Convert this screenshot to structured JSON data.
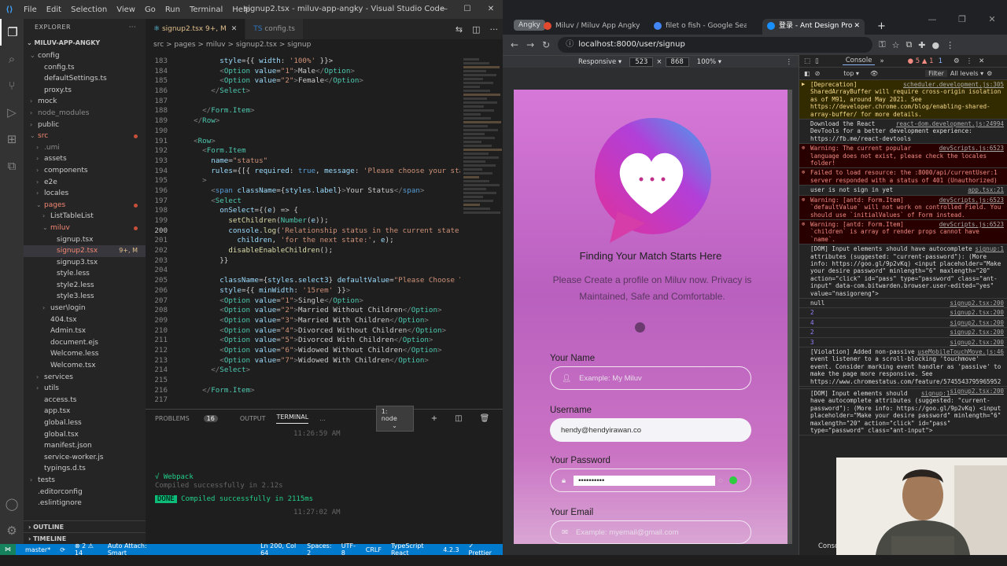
{
  "vscode": {
    "menu": [
      "File",
      "Edit",
      "Selection",
      "View",
      "Go",
      "Run",
      "Terminal",
      "Help"
    ],
    "title": "signup2.tsx - miluv-app-angky - Visual Studio Code",
    "explorer_label": "EXPLORER",
    "project": "MILUV-APP-ANGKY",
    "tree": [
      {
        "label": "config",
        "icon": "chevron-down",
        "indent": 1
      },
      {
        "label": "config.ts",
        "indent": 2
      },
      {
        "label": "defaultSettings.ts",
        "indent": 2
      },
      {
        "label": "proxy.ts",
        "indent": 2
      },
      {
        "label": "mock",
        "icon": "chevron-right",
        "indent": 1
      },
      {
        "label": "node_modules",
        "icon": "chevron-right",
        "indent": 1,
        "dim": true
      },
      {
        "label": "public",
        "icon": "chevron-right",
        "indent": 1
      },
      {
        "label": "src",
        "icon": "chevron-down",
        "indent": 1,
        "error": true,
        "dot": true
      },
      {
        "label": ".umi",
        "icon": "chevron-right",
        "indent": 2,
        "dim": true
      },
      {
        "label": "assets",
        "icon": "chevron-right",
        "indent": 2
      },
      {
        "label": "components",
        "icon": "chevron-right",
        "indent": 2
      },
      {
        "label": "e2e",
        "icon": "chevron-right",
        "indent": 2
      },
      {
        "label": "locales",
        "icon": "chevron-right",
        "indent": 2
      },
      {
        "label": "pages",
        "icon": "chevron-down",
        "indent": 2,
        "error": true,
        "dot": true
      },
      {
        "label": "ListTableList",
        "icon": "chevron-right",
        "indent": 3
      },
      {
        "label": "miluv",
        "icon": "chevron-down",
        "indent": 3,
        "error": true,
        "dot": true
      },
      {
        "label": "signup.tsx",
        "indent": 4
      },
      {
        "label": "signup2.tsx",
        "indent": 4,
        "error": true,
        "selected": true,
        "mod": "9+, M"
      },
      {
        "label": "signup3.tsx",
        "indent": 4
      },
      {
        "label": "style.less",
        "indent": 4
      },
      {
        "label": "style2.less",
        "indent": 4
      },
      {
        "label": "style3.less",
        "indent": 4
      },
      {
        "label": "user\\login",
        "icon": "chevron-right",
        "indent": 3
      },
      {
        "label": "404.tsx",
        "indent": 3
      },
      {
        "label": "Admin.tsx",
        "indent": 3
      },
      {
        "label": "document.ejs",
        "indent": 3
      },
      {
        "label": "Welcome.less",
        "indent": 3
      },
      {
        "label": "Welcome.tsx",
        "indent": 3
      },
      {
        "label": "services",
        "icon": "chevron-right",
        "indent": 2
      },
      {
        "label": "utils",
        "icon": "chevron-right",
        "indent": 2
      },
      {
        "label": "access.ts",
        "indent": 2
      },
      {
        "label": "app.tsx",
        "indent": 2
      },
      {
        "label": "global.less",
        "indent": 2
      },
      {
        "label": "global.tsx",
        "indent": 2
      },
      {
        "label": "manifest.json",
        "indent": 2
      },
      {
        "label": "service-worker.js",
        "indent": 2
      },
      {
        "label": "typings.d.ts",
        "indent": 2
      },
      {
        "label": "tests",
        "icon": "chevron-right",
        "indent": 1
      },
      {
        "label": ".editorconfig",
        "indent": 1
      },
      {
        "label": ".eslintignore",
        "indent": 1
      }
    ],
    "outline": "OUTLINE",
    "timeline": "TIMELINE",
    "tabs": [
      {
        "label": "signup2.tsx",
        "mod": "9+, M",
        "active": true
      },
      {
        "label": "config.ts",
        "active": false
      }
    ],
    "breadcrumb": "src > pages > miluv > signup2.tsx > signup",
    "code": [
      {
        "n": "183",
        "html": "        <span class='a'>style</span>={{ <span class='a'>width</span>: <span class='s'>'100%'</span> }}>"
      },
      {
        "n": "184",
        "html": "        <span class='p'>&lt;</span><span class='t'>Option</span> <span class='a'>value</span>=<span class='s'>\"1\"</span><span class='p'>&gt;</span>Male<span class='p'>&lt;/</span><span class='t'>Option</span><span class='p'>&gt;</span>"
      },
      {
        "n": "185",
        "html": "        <span class='p'>&lt;</span><span class='t'>Option</span> <span class='a'>value</span>=<span class='s'>\"2\"</span><span class='p'>&gt;</span>Female<span class='p'>&lt;/</span><span class='t'>Option</span><span class='p'>&gt;</span>"
      },
      {
        "n": "186",
        "html": "      <span class='p'>&lt;/</span><span class='t'>Select</span><span class='p'>&gt;</span>"
      },
      {
        "n": "187",
        "html": ""
      },
      {
        "n": "188",
        "html": "    <span class='p'>&lt;/</span><span class='t'>Form.Item</span><span class='p'>&gt;</span>"
      },
      {
        "n": "189",
        "html": "  <span class='p'>&lt;/</span><span class='t'>Row</span><span class='p'>&gt;</span>"
      },
      {
        "n": "190",
        "html": ""
      },
      {
        "n": "191",
        "html": "  <span class='p'>&lt;</span><span class='t'>Row</span><span class='p'>&gt;</span>"
      },
      {
        "n": "192",
        "html": "    <span class='p'>&lt;</span><span class='t'>Form.Item</span>"
      },
      {
        "n": "193",
        "html": "      <span class='a'>name</span>=<span class='s'>\"status\"</span>"
      },
      {
        "n": "194",
        "html": "      <span class='a'>rules</span>={[{ <span class='a'>required</span>: <span class='k'>true</span>, <span class='a'>message</span>: <span class='s'>'Please choose your status!'</span>"
      },
      {
        "n": "195",
        "html": "    <span class='p'>&gt;</span>"
      },
      {
        "n": "196",
        "html": "      <span class='p'>&lt;</span><span class='k'>span</span> <span class='a'>className</span>={<span class='v'>styles</span>.<span class='v'>label</span>}<span class='p'>&gt;</span>Your Status<span class='p'>&lt;/</span><span class='k'>span</span><span class='p'>&gt;</span>"
      },
      {
        "n": "197",
        "html": "      <span class='p'>&lt;</span><span class='t'>Select</span>"
      },
      {
        "n": "198",
        "html": "        <span class='a'>onSelect</span>={(<span class='v'>e</span>) =&gt; {"
      },
      {
        "n": "199",
        "html": "          <span class='f'>setChildren</span>(<span class='t'>Number</span>(<span class='v'>e</span>));"
      },
      {
        "n": "200",
        "html": "          <span class='v'>console</span>.<span class='f'>log</span>(<span class='s'>'Relationship status in the current state'</span>,",
        "cur": true
      },
      {
        "n": "201",
        "html": "            <span class='v'>children</span>, <span class='s'>'for the next state:'</span>, <span class='v'>e</span>);"
      },
      {
        "n": "202",
        "html": "          <span class='f'>disableEnableChildren</span>();"
      },
      {
        "n": "203",
        "html": "        }}"
      },
      {
        "n": "204",
        "html": ""
      },
      {
        "n": "205",
        "html": "        <span class='a'>className</span>={<span class='v'>styles</span>.<span class='v'>select3</span>} <span class='a'>defaultValue</span>=<span class='s'>\"Please Choose Your S</span>"
      },
      {
        "n": "206",
        "html": "        <span class='a'>style</span>={{ <span class='a'>minWidth</span>: <span class='s'>'15rem'</span> }}<span class='p'>&gt;</span>"
      },
      {
        "n": "207",
        "html": "        <span class='p'>&lt;</span><span class='t'>Option</span> <span class='a'>value</span>=<span class='s'>\"1\"</span><span class='p'>&gt;</span>Single<span class='p'>&lt;/</span><span class='t'>Option</span><span class='p'>&gt;</span>"
      },
      {
        "n": "208",
        "html": "        <span class='p'>&lt;</span><span class='t'>Option</span> <span class='a'>value</span>=<span class='s'>\"2\"</span><span class='p'>&gt;</span>Married Without Children<span class='p'>&lt;/</span><span class='t'>Option</span><span class='p'>&gt;</span>"
      },
      {
        "n": "209",
        "html": "        <span class='p'>&lt;</span><span class='t'>Option</span> <span class='a'>value</span>=<span class='s'>\"3\"</span><span class='p'>&gt;</span>Married With Children<span class='p'>&lt;/</span><span class='t'>Option</span><span class='p'>&gt;</span>"
      },
      {
        "n": "210",
        "html": "        <span class='p'>&lt;</span><span class='t'>Option</span> <span class='a'>value</span>=<span class='s'>\"4\"</span><span class='p'>&gt;</span>Divorced Without Children<span class='p'>&lt;/</span><span class='t'>Option</span><span class='p'>&gt;</span>"
      },
      {
        "n": "211",
        "html": "        <span class='p'>&lt;</span><span class='t'>Option</span> <span class='a'>value</span>=<span class='s'>\"5\"</span><span class='p'>&gt;</span>Divorced With Children<span class='p'>&lt;/</span><span class='t'>Option</span><span class='p'>&gt;</span>"
      },
      {
        "n": "212",
        "html": "        <span class='p'>&lt;</span><span class='t'>Option</span> <span class='a'>value</span>=<span class='s'>\"6\"</span><span class='p'>&gt;</span>Widowed Without Children<span class='p'>&lt;/</span><span class='t'>Option</span><span class='p'>&gt;</span>"
      },
      {
        "n": "213",
        "html": "        <span class='p'>&lt;</span><span class='t'>Option</span> <span class='a'>value</span>=<span class='s'>\"7\"</span><span class='p'>&gt;</span>Widowed With Children<span class='p'>&lt;/</span><span class='t'>Option</span><span class='p'>&gt;</span>"
      },
      {
        "n": "214",
        "html": "      <span class='p'>&lt;/</span><span class='t'>Select</span><span class='p'>&gt;</span>"
      },
      {
        "n": "215",
        "html": ""
      },
      {
        "n": "216",
        "html": "    <span class='p'>&lt;/</span><span class='t'>Form.Item</span><span class='p'>&gt;</span>"
      },
      {
        "n": "217",
        "html": ""
      }
    ],
    "panel": {
      "problems": "PROBLEMS",
      "problems_count": "16",
      "output": "OUTPUT",
      "terminal": "TERMINAL",
      "more": "...",
      "terminal_select": "1: node",
      "lines": {
        "time1": "11:26:59 AM",
        "webpack": "√ Webpack",
        "compiled1": "Compiled successfully in 2.12s",
        "done": "DONE",
        "compiled2": "Compiled successfully in 2115ms",
        "time2": "11:27:02 AM"
      }
    },
    "status": {
      "branch": "master*",
      "sync": "⟳",
      "errors": "⊗ 2 ⚠ 14",
      "attach": "Auto Attach: Smart",
      "position": "Ln 200, Col 64",
      "spaces": "Spaces: 2",
      "encoding": "UTF-8",
      "eol": "CRLF",
      "lang": "TypeScript React",
      "version": "4.2.3",
      "prettier": "✓ Prettier"
    }
  },
  "chrome": {
    "group": "Angky",
    "tabs": [
      {
        "label": "Miluv / Miluv App Angky - C",
        "color": "#e2492f",
        "active": false
      },
      {
        "label": "filet o fish - Google Search",
        "color": "#4285f4",
        "active": false
      },
      {
        "label": "登录 - Ant Design Pro",
        "color": "#1890ff",
        "active": true
      }
    ],
    "url": "localhost:8000/user/signup",
    "device": {
      "mode": "Responsive ▾",
      "width": "523",
      "height": "868",
      "zoom": "100% ▾"
    },
    "page": {
      "title": "Finding Your Match Starts Here",
      "subtitle": "Please Create a profile on Miluv now. Privacy is Maintained, Safe and Comfortable.",
      "name_label": "Your Name",
      "name_placeholder": "Example: My Miluv",
      "username_label": "Username",
      "username_value": "hendy@hendyirawan.co",
      "password_label": "Your Password",
      "password_value": "••••••••••",
      "email_label": "Your Email",
      "email_placeholder": "Example: myemail@gmail.com"
    },
    "devtools": {
      "console_tab": "Console",
      "error_count": "● 5 ▲ 1",
      "info_count": "1",
      "context": "top",
      "filter": "Filter",
      "levels": "All levels ▾",
      "entries": [
        {
          "kind": "warn",
          "src": "scheduler.development.js:305",
          "text": "[Deprecation] SharedArrayBuffer will require cross-origin isolation as of M91, around May 2021. See https://developer.chrome.com/blog/enabling-shared-array-buffer/ for more details."
        },
        {
          "kind": "info",
          "src": "react-dom.development.js:24994",
          "text": "Download the React DevTools for a better development experience: https://fb.me/react-devtools"
        },
        {
          "kind": "err",
          "src": "devScripts.js:6523",
          "text": "Warning: The current popular language does not exist, please check the locales folder!"
        },
        {
          "kind": "err",
          "src": "",
          "text": "Failed to load resource: the :8000/api/currentUser:1 server responded with a status of 401 (Unauthorized)"
        },
        {
          "kind": "info",
          "src": "app.tsx:21",
          "text": "user is not sign in yet"
        },
        {
          "kind": "err",
          "src": "devScripts.js:6523",
          "text": "Warning: [antd: Form.Item] `defaultValue` will not work on controlled Field. You should use `initialValues` of Form instead."
        },
        {
          "kind": "err",
          "src": "devScripts.js:6523",
          "text": "Warning: [antd: Form.Item] `children` is array of render props cannot have `name`."
        },
        {
          "kind": "info",
          "src": "signup:1",
          "text": "[DOM] Input elements should have autocomplete attributes (suggested: \"current-password\"): (More info: https://goo.gl/9p2vKq) <input placeholder=\"Make your desire password\" minlength=\"6\" maxlength=\"20\" action=\"click\" id=\"pass\" type=\"password\" class=\"ant-input\" data-com.bitwarden.browser.user-edited=\"yes\" value=\"nasigoreng\">"
        },
        {
          "kind": "info",
          "src": "signup2.tsx:200",
          "text": "null"
        },
        {
          "kind": "num",
          "src": "signup2.tsx:200",
          "text": "2"
        },
        {
          "kind": "num",
          "src": "signup2.tsx:200",
          "text": "4"
        },
        {
          "kind": "num",
          "src": "signup2.tsx:200",
          "text": "2"
        },
        {
          "kind": "num",
          "src": "signup2.tsx:200",
          "text": "3"
        },
        {
          "kind": "info",
          "src": "useMobileTouchMove.js:46",
          "text": "[Violation] Added non-passive event listener to a scroll-blocking 'touchmove' event. Consider marking event handler as 'passive' to make the page more responsive. See https://www.chromestatus.com/feature/5745543795965952"
        },
        {
          "kind": "info",
          "src": "signup2.tsx:200",
          "text": ""
        },
        {
          "kind": "info",
          "src": "signup:1",
          "text": "[DOM] Input elements should have autocomplete attributes (suggested: \"current-password\"): (More info: https://goo.gl/9p2vKq) <input placeholder=\"Make your desire password\" minlength=\"6\" maxlength=\"20\" action=\"click\" id=\"pass\" type=\"password\" class=\"ant-input\">"
        }
      ],
      "drawer_tab": "Console"
    }
  }
}
